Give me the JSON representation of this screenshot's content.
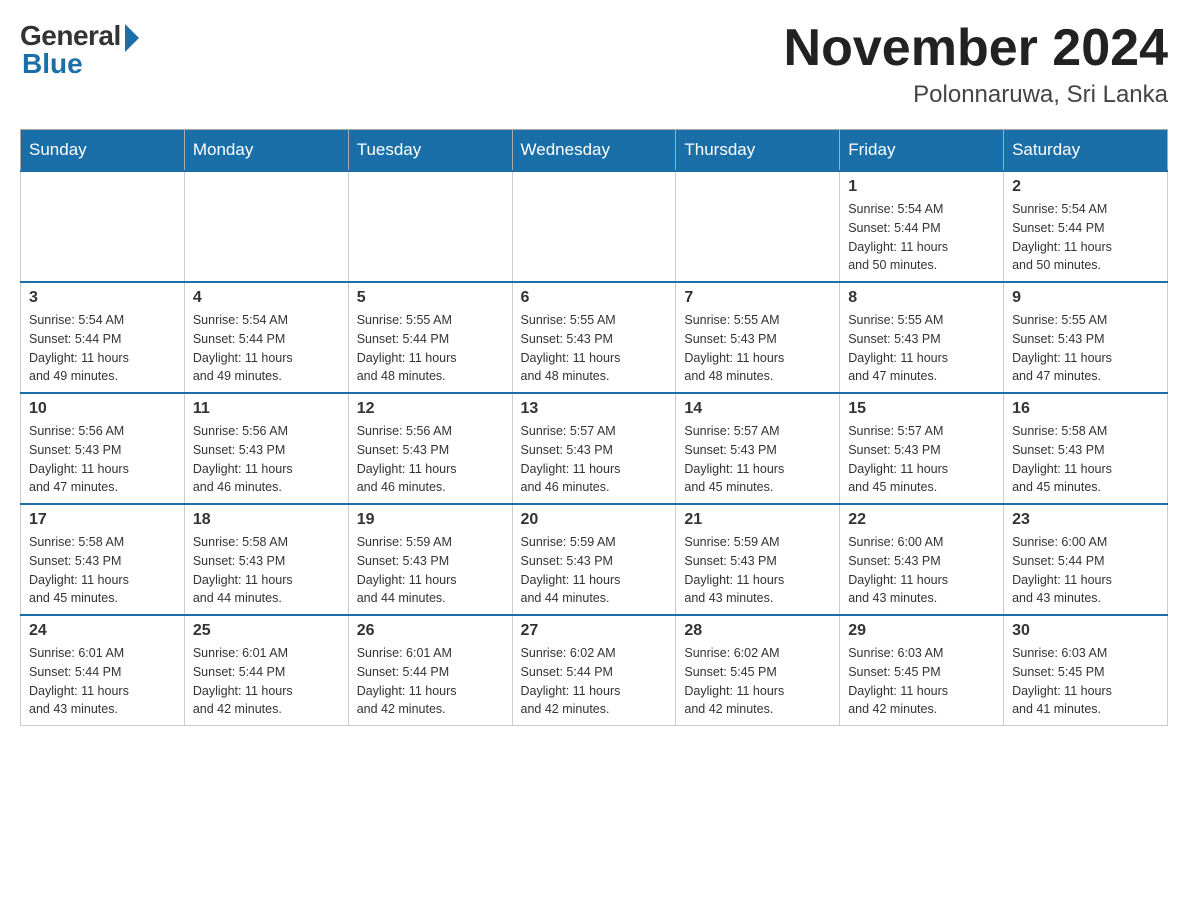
{
  "logo": {
    "general": "General",
    "blue": "Blue"
  },
  "title": {
    "month": "November 2024",
    "location": "Polonnaruwa, Sri Lanka"
  },
  "weekdays": [
    "Sunday",
    "Monday",
    "Tuesday",
    "Wednesday",
    "Thursday",
    "Friday",
    "Saturday"
  ],
  "weeks": [
    [
      {
        "day": "",
        "info": ""
      },
      {
        "day": "",
        "info": ""
      },
      {
        "day": "",
        "info": ""
      },
      {
        "day": "",
        "info": ""
      },
      {
        "day": "",
        "info": ""
      },
      {
        "day": "1",
        "info": "Sunrise: 5:54 AM\nSunset: 5:44 PM\nDaylight: 11 hours\nand 50 minutes."
      },
      {
        "day": "2",
        "info": "Sunrise: 5:54 AM\nSunset: 5:44 PM\nDaylight: 11 hours\nand 50 minutes."
      }
    ],
    [
      {
        "day": "3",
        "info": "Sunrise: 5:54 AM\nSunset: 5:44 PM\nDaylight: 11 hours\nand 49 minutes."
      },
      {
        "day": "4",
        "info": "Sunrise: 5:54 AM\nSunset: 5:44 PM\nDaylight: 11 hours\nand 49 minutes."
      },
      {
        "day": "5",
        "info": "Sunrise: 5:55 AM\nSunset: 5:44 PM\nDaylight: 11 hours\nand 48 minutes."
      },
      {
        "day": "6",
        "info": "Sunrise: 5:55 AM\nSunset: 5:43 PM\nDaylight: 11 hours\nand 48 minutes."
      },
      {
        "day": "7",
        "info": "Sunrise: 5:55 AM\nSunset: 5:43 PM\nDaylight: 11 hours\nand 48 minutes."
      },
      {
        "day": "8",
        "info": "Sunrise: 5:55 AM\nSunset: 5:43 PM\nDaylight: 11 hours\nand 47 minutes."
      },
      {
        "day": "9",
        "info": "Sunrise: 5:55 AM\nSunset: 5:43 PM\nDaylight: 11 hours\nand 47 minutes."
      }
    ],
    [
      {
        "day": "10",
        "info": "Sunrise: 5:56 AM\nSunset: 5:43 PM\nDaylight: 11 hours\nand 47 minutes."
      },
      {
        "day": "11",
        "info": "Sunrise: 5:56 AM\nSunset: 5:43 PM\nDaylight: 11 hours\nand 46 minutes."
      },
      {
        "day": "12",
        "info": "Sunrise: 5:56 AM\nSunset: 5:43 PM\nDaylight: 11 hours\nand 46 minutes."
      },
      {
        "day": "13",
        "info": "Sunrise: 5:57 AM\nSunset: 5:43 PM\nDaylight: 11 hours\nand 46 minutes."
      },
      {
        "day": "14",
        "info": "Sunrise: 5:57 AM\nSunset: 5:43 PM\nDaylight: 11 hours\nand 45 minutes."
      },
      {
        "day": "15",
        "info": "Sunrise: 5:57 AM\nSunset: 5:43 PM\nDaylight: 11 hours\nand 45 minutes."
      },
      {
        "day": "16",
        "info": "Sunrise: 5:58 AM\nSunset: 5:43 PM\nDaylight: 11 hours\nand 45 minutes."
      }
    ],
    [
      {
        "day": "17",
        "info": "Sunrise: 5:58 AM\nSunset: 5:43 PM\nDaylight: 11 hours\nand 45 minutes."
      },
      {
        "day": "18",
        "info": "Sunrise: 5:58 AM\nSunset: 5:43 PM\nDaylight: 11 hours\nand 44 minutes."
      },
      {
        "day": "19",
        "info": "Sunrise: 5:59 AM\nSunset: 5:43 PM\nDaylight: 11 hours\nand 44 minutes."
      },
      {
        "day": "20",
        "info": "Sunrise: 5:59 AM\nSunset: 5:43 PM\nDaylight: 11 hours\nand 44 minutes."
      },
      {
        "day": "21",
        "info": "Sunrise: 5:59 AM\nSunset: 5:43 PM\nDaylight: 11 hours\nand 43 minutes."
      },
      {
        "day": "22",
        "info": "Sunrise: 6:00 AM\nSunset: 5:43 PM\nDaylight: 11 hours\nand 43 minutes."
      },
      {
        "day": "23",
        "info": "Sunrise: 6:00 AM\nSunset: 5:44 PM\nDaylight: 11 hours\nand 43 minutes."
      }
    ],
    [
      {
        "day": "24",
        "info": "Sunrise: 6:01 AM\nSunset: 5:44 PM\nDaylight: 11 hours\nand 43 minutes."
      },
      {
        "day": "25",
        "info": "Sunrise: 6:01 AM\nSunset: 5:44 PM\nDaylight: 11 hours\nand 42 minutes."
      },
      {
        "day": "26",
        "info": "Sunrise: 6:01 AM\nSunset: 5:44 PM\nDaylight: 11 hours\nand 42 minutes."
      },
      {
        "day": "27",
        "info": "Sunrise: 6:02 AM\nSunset: 5:44 PM\nDaylight: 11 hours\nand 42 minutes."
      },
      {
        "day": "28",
        "info": "Sunrise: 6:02 AM\nSunset: 5:45 PM\nDaylight: 11 hours\nand 42 minutes."
      },
      {
        "day": "29",
        "info": "Sunrise: 6:03 AM\nSunset: 5:45 PM\nDaylight: 11 hours\nand 42 minutes."
      },
      {
        "day": "30",
        "info": "Sunrise: 6:03 AM\nSunset: 5:45 PM\nDaylight: 11 hours\nand 41 minutes."
      }
    ]
  ]
}
